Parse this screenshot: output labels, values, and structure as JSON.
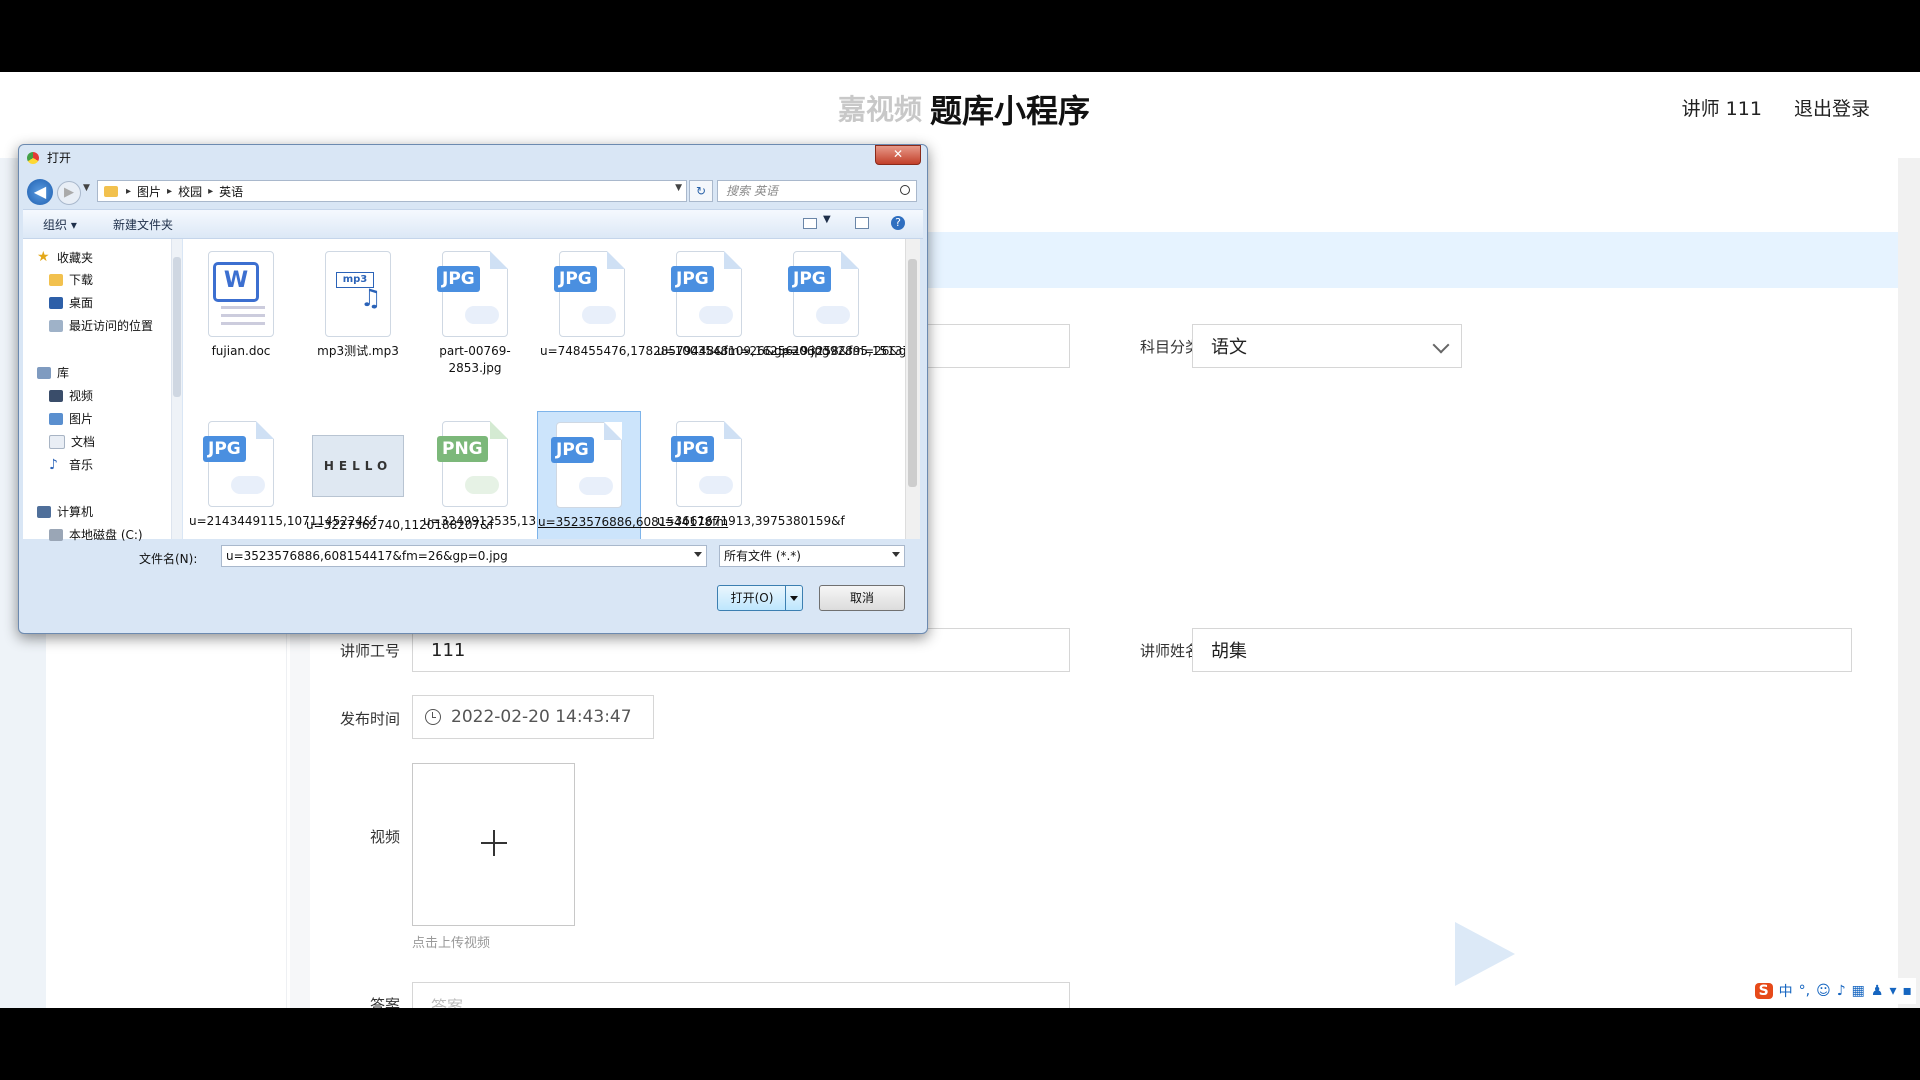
{
  "web": {
    "brand": "题库小程序",
    "brand_partial": "嘉视频",
    "user": "讲师 111",
    "logout": "退出登录",
    "form": {
      "subject_label": "科目分类",
      "subject_value": "语文",
      "teacher_id_label": "讲师工号",
      "teacher_id_value": "111",
      "teacher_name_label": "讲师姓名",
      "teacher_name_value": "胡集",
      "publish_time_label": "发布时间",
      "publish_time_value": "2022-02-20 14:43:47",
      "video_label": "视频",
      "upload_hint": "点击上传视频",
      "answer_label": "答案",
      "answer_placeholder": "答案"
    },
    "ime": {
      "logo": "S",
      "mode": "中"
    }
  },
  "dialog": {
    "title": "打开",
    "close": "✕",
    "breadcrumb": [
      "图片",
      "校园",
      "英语"
    ],
    "search_placeholder": "搜索 英语",
    "toolbar": {
      "organize": "组织 ▾",
      "new_folder": "新建文件夹"
    },
    "nav": {
      "favorites": "收藏夹",
      "downloads": "下载",
      "desktop": "桌面",
      "recent": "最近访问的位置",
      "libraries": "库",
      "videos": "视频",
      "pictures": "图片",
      "documents": "文档",
      "music": "音乐",
      "computer": "计算机",
      "local_disk": "本地磁盘 (C:)"
    },
    "files": [
      {
        "name": "fujian.doc",
        "type": "doc"
      },
      {
        "name": "mp3测试.mp3",
        "type": "mp3"
      },
      {
        "name": "part-00769-2853.jpg",
        "type": "JPG"
      },
      {
        "name": "u=748455476,17828579448&fm=26&gp=0.jpg",
        "type": "JPG"
      },
      {
        "name": "u=1003548109,16256193258&fm=26&gp=0.jpg",
        "type": "JPG"
      },
      {
        "name": "u=2060392895,1513740172&fm=26&gp=0.jpg",
        "type": "JPG"
      },
      {
        "name": "u=2143449115,1071145224&f",
        "type": "JPG"
      },
      {
        "name": "u=3227362740,1120188207&f",
        "type": "img"
      },
      {
        "name": "u=3249912535,1318076148&f",
        "type": "PNG"
      },
      {
        "name": "u=3523576886,6081544178fm",
        "type": "JPG"
      },
      {
        "name": "u=3661671913,3975380159&f",
        "type": "JPG"
      }
    ],
    "hello_text": "HELLO",
    "filename_label": "文件名(N):",
    "filename_value": "u=3523576886,608154417&fm=26&gp=0.jpg",
    "filetype": "所有文件 (*.*)",
    "open_button": "打开(O)",
    "cancel_button": "取消"
  },
  "colors": {
    "jpg_badge": "#4a8fe0",
    "png_badge": "#7cb87a",
    "selection": "#cce4fb"
  }
}
